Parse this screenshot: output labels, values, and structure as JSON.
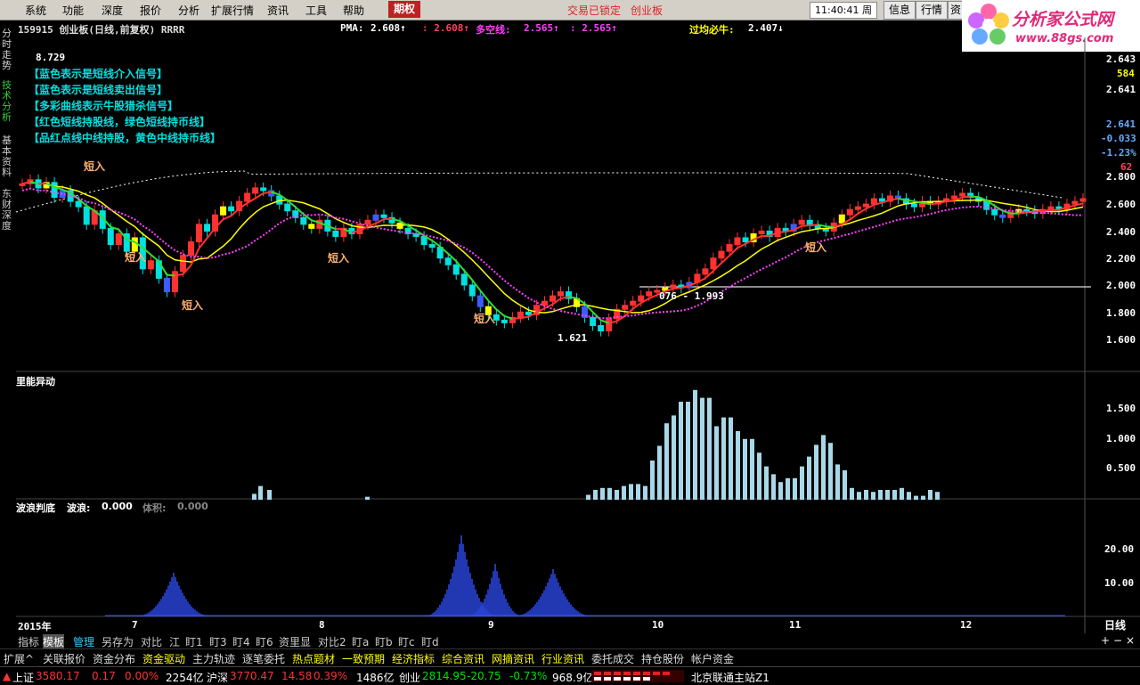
{
  "menubar": {
    "items": [
      "系统",
      "功能",
      "深度",
      "报价",
      "分析",
      "扩展行情",
      "资讯",
      "工具",
      "帮助"
    ],
    "highlight_tab": "期权",
    "lock_status": "交易已锁定",
    "board": "创业板",
    "clock": "11:40:41",
    "weekday": "周五",
    "right_buttons": [
      "信息",
      "行情",
      "资"
    ]
  },
  "logo": {
    "title": "分析家公式网",
    "url": "www.88gs.com"
  },
  "side_tabs": [
    "分时走势",
    "技术分析",
    "基本资料",
    "东财深度"
  ],
  "header": {
    "code_name": "159915 创业板(日线,前复权) RRRR",
    "pma_label": "PMA:",
    "pma_v1": "2.608↑",
    "pma_v2": ": 2.608↑",
    "multi_label": "多空线:",
    "multi_v1": "2.565↑",
    "multi_v2": ": 2.565↑",
    "guojun_label": "过均必牛:",
    "guojun_v": "2.407↓"
  },
  "legend": [
    "【蓝色表示是短线介入信号】",
    "【蓝色表示是短线卖出信号】",
    "【多彩曲线表示牛股猎杀信号】",
    "【红色短线持股线，绿色短线持币线】",
    "【品红点线中线持股，黄色中线持币线】"
  ],
  "annotations": {
    "high": "8.729",
    "low": "1.621",
    "range_label": "076 - 1.993",
    "entry_signal": "短入"
  },
  "price_axis": {
    "ticks": [
      "2.643",
      "584",
      "2.641",
      "2.641",
      "-0.033",
      "-1.23%",
      "62",
      "2.800",
      "2.600",
      "2.400",
      "2.200",
      "2.000",
      "1.800",
      "1.600"
    ]
  },
  "volume_panel": {
    "title": "里能异动",
    "ticks": [
      "1.500",
      "1.000",
      "0.500"
    ]
  },
  "wave_panel": {
    "title": "波浪判底",
    "label_wave": "波浪:",
    "wave_value": "0.000",
    "label_volume": "体积:",
    "volume_value": "0.000",
    "ticks": [
      "20.00",
      "10.00"
    ]
  },
  "x_axis": {
    "labels": [
      "2015年",
      "7",
      "8",
      "9",
      "10",
      "11",
      "12",
      "日线"
    ]
  },
  "bottom_tabs": [
    "指标",
    "模板",
    "管理",
    "另存为",
    "对比",
    "江",
    "盯1",
    "盯3",
    "盯4",
    "盯6",
    "资里显",
    "对比2",
    "盯a",
    "盯b",
    "盯c",
    "盯d"
  ],
  "function_menu": [
    "扩展^",
    "关联报价",
    "资金分布",
    "资金驱动",
    "主力轨迹",
    "逐笔委托",
    "热点题材",
    "一致预期",
    "经济指标",
    "综合资讯",
    "网摘资讯",
    "行业资讯",
    "委托成交",
    "持仓股份",
    "帐户资金"
  ],
  "status": {
    "sh_label": "上证",
    "sh_value": "3580.17",
    "sh_chg": "0.17",
    "sh_pct": "0.00%",
    "sh_amt": "2254亿",
    "hs_label": "沪深",
    "hs_value": "3770.47",
    "hs_chg": "14.58",
    "hs_pct": "0.39%",
    "hs_amt": "1486亿",
    "cy_label": "创业",
    "cy_value": "2814.95",
    "cy_chg": "-20.75",
    "cy_pct": "-0.73%",
    "cy_amt": "968.9亿",
    "server": "北京联通主站Z1"
  },
  "colors": {
    "up": "#ff3232",
    "down": "#00e0e0",
    "yellow": "#ffff00",
    "magenta": "#ff40ff",
    "green": "#33dd33",
    "blue": "#3d5cff",
    "wave": "#3050ff",
    "volbar": "#a8d8e8"
  }
}
